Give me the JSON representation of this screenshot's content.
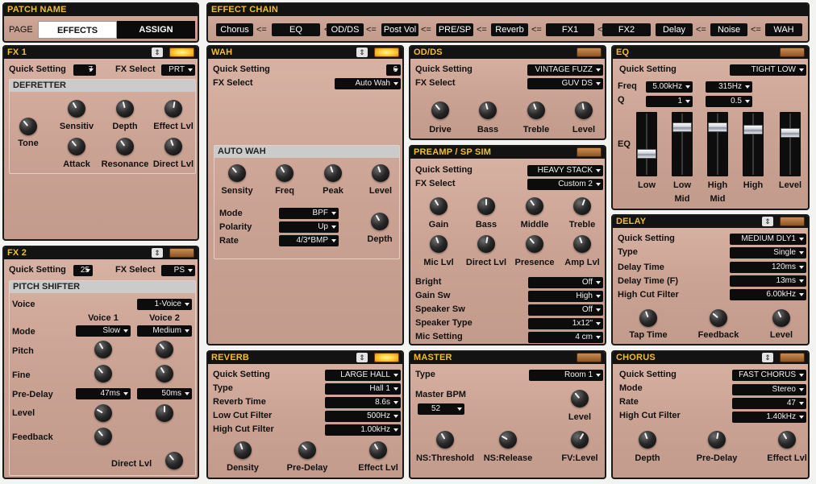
{
  "patch": {
    "title": "PATCH NAME",
    "page_label": "PAGE",
    "tab_effects": "EFFECTS",
    "tab_assign": "ASSIGN"
  },
  "chain": {
    "title": "EFFECT CHAIN",
    "arrow": "<=",
    "items": [
      "Chorus",
      "EQ",
      "OD/DS",
      "Post Vol",
      "PRE/SP",
      "Reverb",
      "FX1",
      "FX2",
      "Delay",
      "Noise",
      "WAH"
    ]
  },
  "fx1": {
    "title": "FX 1",
    "qs_label": "Quick Setting",
    "qs_value": "7",
    "fxsel_label": "FX Select",
    "fxsel_value": "PRT",
    "sub_title": "DEFRETTER",
    "tone": "Tone",
    "sensitiv": "Sensitiv",
    "depth": "Depth",
    "effect_lvl": "Effect Lvl",
    "attack": "Attack",
    "resonance": "Resonance",
    "direct_lvl": "Direct Lvl"
  },
  "fx2": {
    "title": "FX 2",
    "qs_label": "Quick Setting",
    "qs_value": "25",
    "fxsel_label": "FX Select",
    "fxsel_value": "PS",
    "sub_title": "PITCH SHIFTER",
    "voice_label": "Voice",
    "voice_value": "1-Voice",
    "voice1": "Voice 1",
    "voice2": "Voice 2",
    "mode_label": "Mode",
    "mode1": "Slow",
    "mode2": "Medium",
    "pitch": "Pitch",
    "fine": "Fine",
    "predelay_label": "Pre-Delay",
    "predelay1": "47ms",
    "predelay2": "50ms",
    "level": "Level",
    "feedback": "Feedback",
    "direct_lvl": "Direct Lvl"
  },
  "wah": {
    "title": "WAH",
    "qs_label": "Quick Setting",
    "qs_value": "6",
    "fxsel_label": "FX Select",
    "fxsel_value": "Auto Wah",
    "sub_title": "AUTO WAH",
    "sensity": "Sensity",
    "freq": "Freq",
    "peak": "Peak",
    "level": "Level",
    "mode_label": "Mode",
    "mode_value": "BPF",
    "polarity_label": "Polarity",
    "polarity_value": "Up",
    "rate_label": "Rate",
    "rate_value": "4/3*BMP",
    "depth": "Depth"
  },
  "odds": {
    "title": "OD/DS",
    "qs_label": "Quick Setting",
    "qs_value": "VINTAGE FUZZ",
    "fxsel_label": "FX Select",
    "fxsel_value": "GUV DS",
    "drive": "Drive",
    "bass": "Bass",
    "treble": "Treble",
    "level": "Level"
  },
  "preamp": {
    "title": "PREAMP / SP SIM",
    "qs_label": "Quick Setting",
    "qs_value": "HEAVY STACK",
    "fxsel_label": "FX Select",
    "fxsel_value": "Custom 2",
    "gain": "Gain",
    "bass": "Bass",
    "middle": "Middle",
    "treble": "Treble",
    "mic_lvl": "Mic Lvl",
    "direct_lvl": "Direct Lvl",
    "presence": "Presence",
    "amp_lvl": "Amp Lvl",
    "bright_label": "Bright",
    "bright_value": "Off",
    "gainsw_label": "Gain Sw",
    "gainsw_value": "High",
    "spksw_label": "Speaker Sw",
    "spksw_value": "Off",
    "spktype_label": "Speaker Type",
    "spktype_value": "1x12\"",
    "mic_label": "Mic Setting",
    "mic_value": "4 cm"
  },
  "eq": {
    "title": "EQ",
    "qs_label": "Quick Setting",
    "qs_value": "TIGHT LOW",
    "freq_label": "Freq",
    "freq1": "5.00kHz",
    "freq2": "315Hz",
    "q_label": "Q",
    "q1": "1",
    "q2": "0.5",
    "eq_label": "EQ",
    "low": "Low",
    "low_mid_1": "Low",
    "low_mid_2": "Mid",
    "high_mid_1": "High",
    "high_mid_2": "Mid",
    "high": "High",
    "level": "Level",
    "fader_levels": [
      0.3,
      0.81,
      0.81,
      0.76,
      0.7
    ]
  },
  "delay": {
    "title": "DELAY",
    "qs_label": "Quick Setting",
    "qs_value": "MEDIUM DLY1",
    "type_label": "Type",
    "type_value": "Single",
    "time_label": "Delay Time",
    "time_value": "120ms",
    "timef_label": "Delay Time (F)",
    "timef_value": "13ms",
    "hcf_label": "High Cut Filter",
    "hcf_value": "6.00kHz",
    "tap_time": "Tap Time",
    "feedback": "Feedback",
    "level": "Level"
  },
  "reverb": {
    "title": "REVERB",
    "qs_label": "Quick Setting",
    "qs_value": "LARGE HALL",
    "type_label": "Type",
    "type_value": "Hall 1",
    "time_label": "Reverb Time",
    "time_value": "8.6s",
    "lcf_label": "Low Cut Filter",
    "lcf_value": "500Hz",
    "hcf_label": "High Cut Filter",
    "hcf_value": "1.00kHz",
    "density": "Density",
    "predelay": "Pre-Delay",
    "effect_lvl": "Effect Lvl"
  },
  "master": {
    "title": "MASTER",
    "type_label": "Type",
    "type_value": "Room 1",
    "bpm_label": "Master BPM",
    "bpm_value": "52",
    "level": "Level",
    "ns_threshold": "NS:Threshold",
    "ns_release": "NS:Release",
    "fv_level": "FV:Level"
  },
  "chorus": {
    "title": "CHORUS",
    "qs_label": "Quick Setting",
    "qs_value": "FAST CHORUS",
    "mode_label": "Mode",
    "mode_value": "Stereo",
    "rate_label": "Rate",
    "rate_value": "47",
    "hcf_label": "High Cut Filter",
    "hcf_value": "1.40kHz",
    "depth": "Depth",
    "predelay": "Pre-Delay",
    "effect_lvl": "Effect Lvl"
  },
  "colors": {
    "panel_bg": "#caa293",
    "header_bg": "#131313",
    "header_text": "#f3c023",
    "led_on": "#ffd23a",
    "led_off": "#a86a35"
  },
  "icons": {
    "panel_caption": "up-down-arrows-icon",
    "panel_led": "indicator-led-icon"
  }
}
